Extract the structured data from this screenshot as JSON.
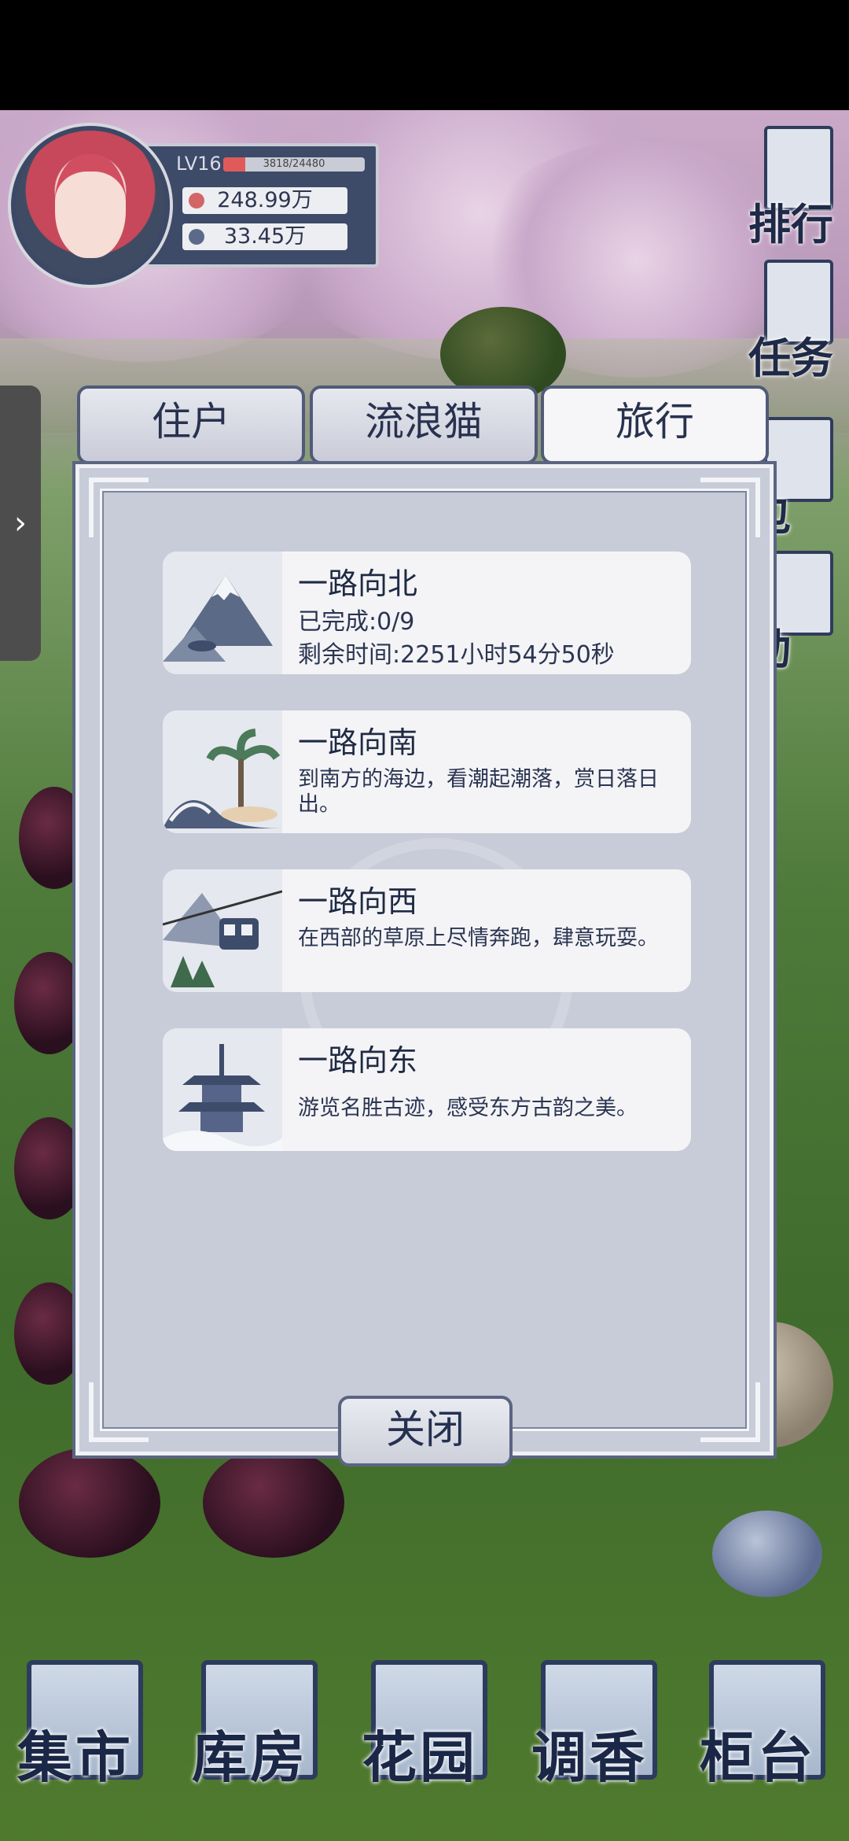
{
  "profile": {
    "level": "LV16",
    "exp_text": "3818/24480",
    "exp_fraction": 0.156,
    "currency_1": "248.99万",
    "currency_2": "33.45万"
  },
  "right_menu": {
    "ranking": "排行",
    "tasks": "任务",
    "bag": "包",
    "event": "动"
  },
  "tabs": [
    {
      "label": "住户",
      "active": false
    },
    {
      "label": "流浪猫",
      "active": false
    },
    {
      "label": "旅行",
      "active": true
    }
  ],
  "trips": [
    {
      "title": "一路向北",
      "line1": "已完成:0/9",
      "line2": "剩余时间:2251小时54分50秒"
    },
    {
      "title": "一路向南",
      "desc": "到南方的海边，看潮起潮落，赏日落日出。"
    },
    {
      "title": "一路向西",
      "desc": "在西部的草原上尽情奔跑，肆意玩耍。"
    },
    {
      "title": "一路向东",
      "desc": "游览名胜古迹，感受东方古韵之美。"
    }
  ],
  "close_label": "关闭",
  "bottom_nav": [
    "集市",
    "库房",
    "花园",
    "调香",
    "柜台"
  ],
  "colors": {
    "ink": "#1f2a44",
    "panel": "#c8cbd8",
    "frame": "#5b6582",
    "card": "#f4f4f6"
  }
}
